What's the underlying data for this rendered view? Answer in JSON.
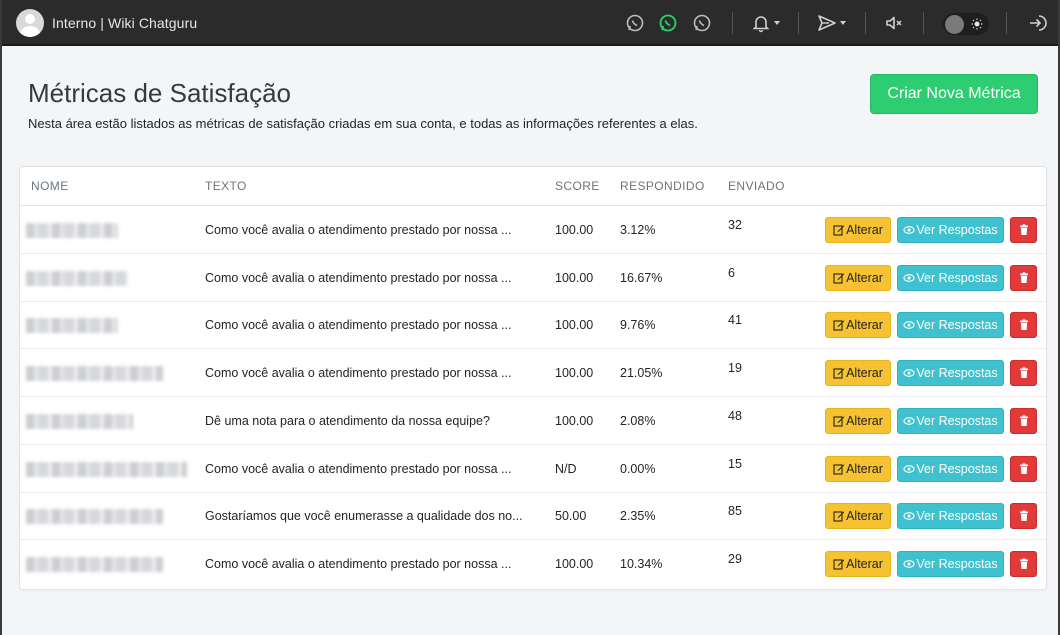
{
  "topbar": {
    "title": "Interno | Wiki Chatguru"
  },
  "header": {
    "title": "Métricas de Satisfação",
    "subtitle": "Nesta área estão listados as métricas de satisfação criadas em sua conta, e todas as informações referentes a elas.",
    "create_button": "Criar Nova Métrica"
  },
  "table": {
    "columns": [
      "NOME",
      "TEXTO",
      "SCORE",
      "RESPONDIDO",
      "ENVIADO"
    ],
    "rows": [
      {
        "texto": "Como você avalia o atendimento prestado por nossa ...",
        "score": "100.00",
        "respondido": "3.12%",
        "enviado": "32"
      },
      {
        "texto": "Como você avalia o atendimento prestado por nossa ...",
        "score": "100.00",
        "respondido": "16.67%",
        "enviado": "6"
      },
      {
        "texto": "Como você avalia o atendimento prestado por nossa ...",
        "score": "100.00",
        "respondido": "9.76%",
        "enviado": "41"
      },
      {
        "texto": "Como você avalia o atendimento prestado por nossa ...",
        "score": "100.00",
        "respondido": "21.05%",
        "enviado": "19"
      },
      {
        "texto": "Dê uma nota para o atendimento da nossa equipe?",
        "score": "100.00",
        "respondido": "2.08%",
        "enviado": "48"
      },
      {
        "texto": "Como você avalia o atendimento prestado por nossa ...",
        "score": "N/D",
        "respondido": "0.00%",
        "enviado": "15"
      },
      {
        "texto": "Gostaríamos que você enumerasse a qualidade dos no...",
        "score": "50.00",
        "respondido": "2.35%",
        "enviado": "85"
      },
      {
        "texto": "Como você avalia o atendimento prestado por nossa ...",
        "score": "100.00",
        "respondido": "10.34%",
        "enviado": "29"
      }
    ],
    "actions": {
      "edit_label": "Alterar",
      "view_label": "Ver Respostas"
    }
  },
  "colors": {
    "topbar": "#2b2b2b",
    "create": "#2fcd72",
    "edit": "#f7c232",
    "view": "#3fc1cf",
    "delete": "#e23a3a",
    "whatsapp_active": "#25d366"
  }
}
